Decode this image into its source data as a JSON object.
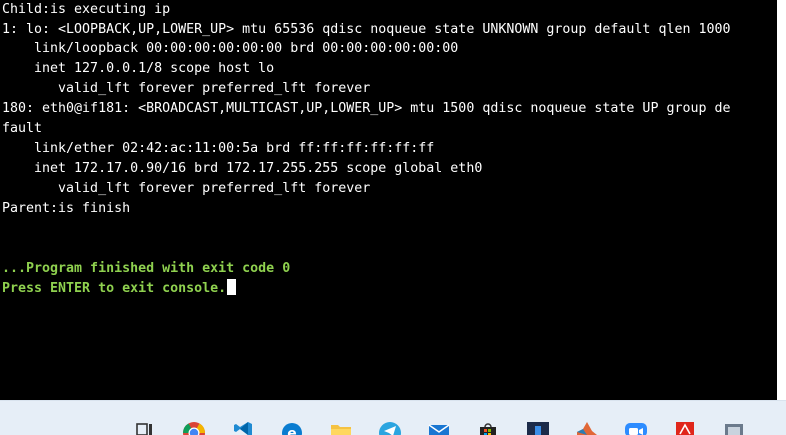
{
  "terminal": {
    "lines": [
      "Child:is executing ip",
      "1: lo: <LOOPBACK,UP,LOWER_UP> mtu 65536 qdisc noqueue state UNKNOWN group default qlen 1000",
      "    link/loopback 00:00:00:00:00:00 brd 00:00:00:00:00:00",
      "    inet 127.0.0.1/8 scope host lo",
      "       valid_lft forever preferred_lft forever",
      "180: eth0@if181: <BROADCAST,MULTICAST,UP,LOWER_UP> mtu 1500 qdisc noqueue state UP group de",
      "fault",
      "    link/ether 02:42:ac:11:00:5a brd ff:ff:ff:ff:ff:ff",
      "    inet 172.17.0.90/16 brd 172.17.255.255 scope global eth0",
      "       valid_lft forever preferred_lft forever",
      "Parent:is finish"
    ],
    "finished_message": "...Program finished with exit code 0",
    "prompt_message": "Press ENTER to exit console."
  },
  "taskbar": {
    "icons": [
      "task-view-icon",
      "chrome-icon",
      "vscode-icon",
      "edge-icon",
      "file-explorer-icon",
      "telegram-icon",
      "mail-icon",
      "store-icon",
      "ide-icon",
      "matlab-icon",
      "zoom-icon",
      "pdf-reader-icon",
      "app-icon"
    ]
  },
  "colors": {
    "background": "#000000",
    "text": "#ffffff",
    "success_text": "#8fd14f",
    "taskbar": "#e6eef7"
  }
}
